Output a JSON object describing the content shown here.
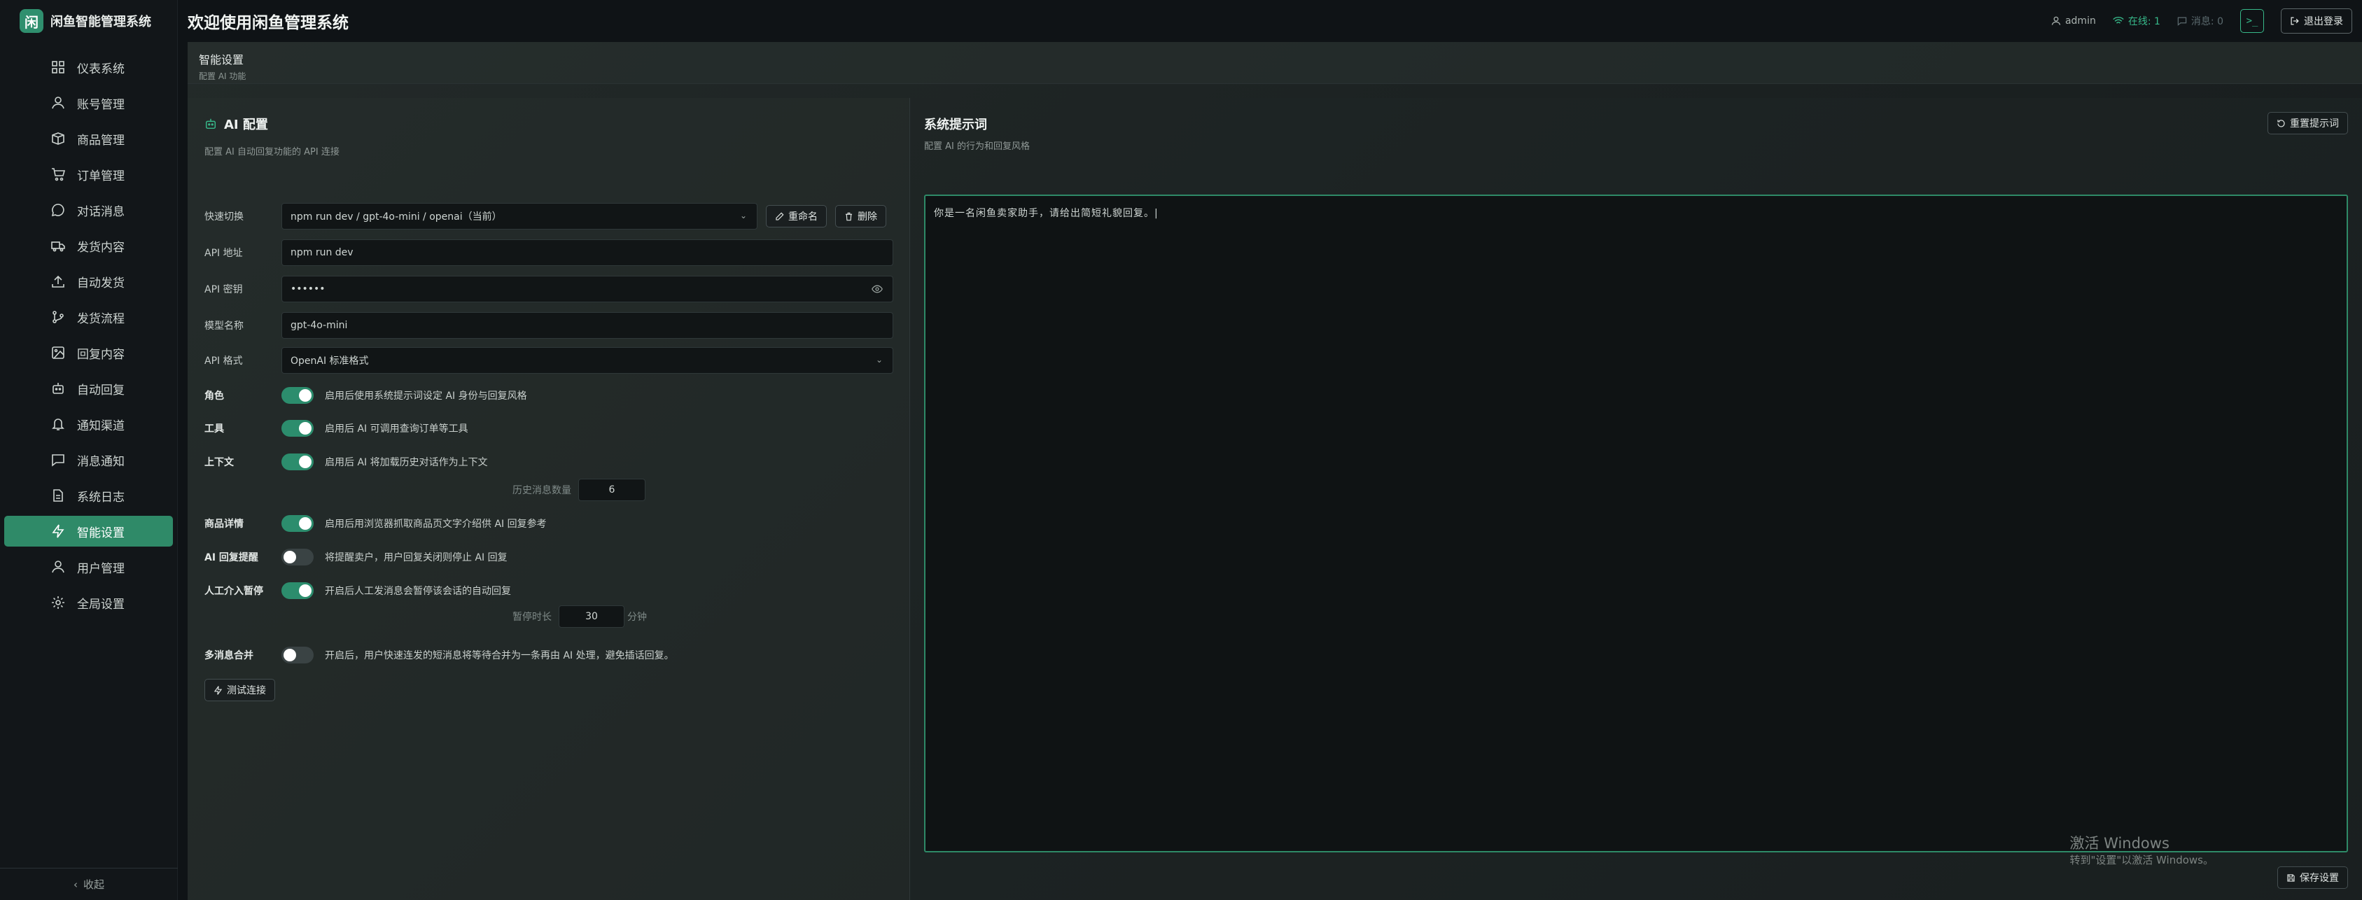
{
  "brand": {
    "logo_char": "闲",
    "name": "闲鱼智能管理系统"
  },
  "header": {
    "title": "欢迎使用闲鱼管理系统",
    "user": "admin",
    "online": "在线: 1",
    "messages": "消息: 0",
    "terminal": ">_",
    "logout": "退出登录"
  },
  "sidebar": {
    "items": [
      {
        "label": "仪表系统",
        "icon": "dashboard-icon"
      },
      {
        "label": "账号管理",
        "icon": "user-icon"
      },
      {
        "label": "商品管理",
        "icon": "box-icon"
      },
      {
        "label": "订单管理",
        "icon": "cart-icon"
      },
      {
        "label": "对话消息",
        "icon": "chat-icon"
      },
      {
        "label": "发货内容",
        "icon": "truck-icon"
      },
      {
        "label": "自动发货",
        "icon": "upload-icon"
      },
      {
        "label": "发货流程",
        "icon": "flow-icon"
      },
      {
        "label": "回复内容",
        "icon": "image-icon"
      },
      {
        "label": "自动回复",
        "icon": "bot-icon"
      },
      {
        "label": "通知渠道",
        "icon": "bell-icon"
      },
      {
        "label": "消息通知",
        "icon": "message-icon"
      },
      {
        "label": "系统日志",
        "icon": "log-icon"
      },
      {
        "label": "智能设置",
        "icon": "zap-icon"
      },
      {
        "label": "用户管理",
        "icon": "users-icon"
      },
      {
        "label": "全局设置",
        "icon": "gear-icon"
      }
    ],
    "active_index": 13,
    "collapse_label": "收起"
  },
  "page": {
    "title": "智能设置",
    "subtitle": "配置 AI 功能"
  },
  "ai_config": {
    "title": "AI 配置",
    "subtitle": "配置 AI 自动回复功能的 API 连接",
    "quick_switch": {
      "label": "快速切换",
      "value": "npm run dev / gpt-4o-mini / openai（当前）",
      "rename": "重命名",
      "delete": "删除"
    },
    "api_url": {
      "label": "API 地址",
      "value": "npm run dev"
    },
    "api_key": {
      "label": "API 密钥",
      "value": "••••••"
    },
    "model": {
      "label": "模型名称",
      "value": "gpt-4o-mini"
    },
    "api_format": {
      "label": "API 格式",
      "value": "OpenAI 标准格式"
    },
    "toggles": [
      {
        "label": "角色",
        "on": true,
        "desc": "启用后使用系统提示词设定 AI 身份与回复风格"
      },
      {
        "label": "工具",
        "on": true,
        "desc": "启用后 AI 可调用查询订单等工具"
      },
      {
        "label": "上下文",
        "on": true,
        "desc": "启用后 AI 将加载历史对话作为上下文"
      },
      {
        "label": "商品详情",
        "on": true,
        "desc": "启用后用浏览器抓取商品页文字介绍供 AI 回复参考"
      },
      {
        "label": "AI 回复提醒",
        "on": false,
        "desc": "将提醒卖户，用户回复关闭则停止 AI 回复"
      },
      {
        "label": "人工介入暂停",
        "on": true,
        "desc": "开启后人工发消息会暂停该会话的自动回复"
      },
      {
        "label": "多消息合并",
        "on": false,
        "desc": "开启后，用户快速连发的短消息将等待合并为一条再由 AI 处理，避免插话回复。"
      }
    ],
    "history": {
      "label": "历史消息数量",
      "value": "6"
    },
    "pause": {
      "label": "暂停时长",
      "value": "30",
      "unit": "分钟"
    },
    "test_button": "测试连接"
  },
  "system_prompt": {
    "title": "系统提示词",
    "subtitle": "配置 AI 的行为和回复风格",
    "reset_button": "重置提示词",
    "value": "你是一名闲鱼卖家助手，请给出简短礼貌回复。",
    "save_button": "保存设置"
  },
  "watermark": {
    "line1": "激活 Windows",
    "line2": "转到\"设置\"以激活 Windows。"
  },
  "colors": {
    "accent": "#2f8a68",
    "online": "#37b98a"
  }
}
